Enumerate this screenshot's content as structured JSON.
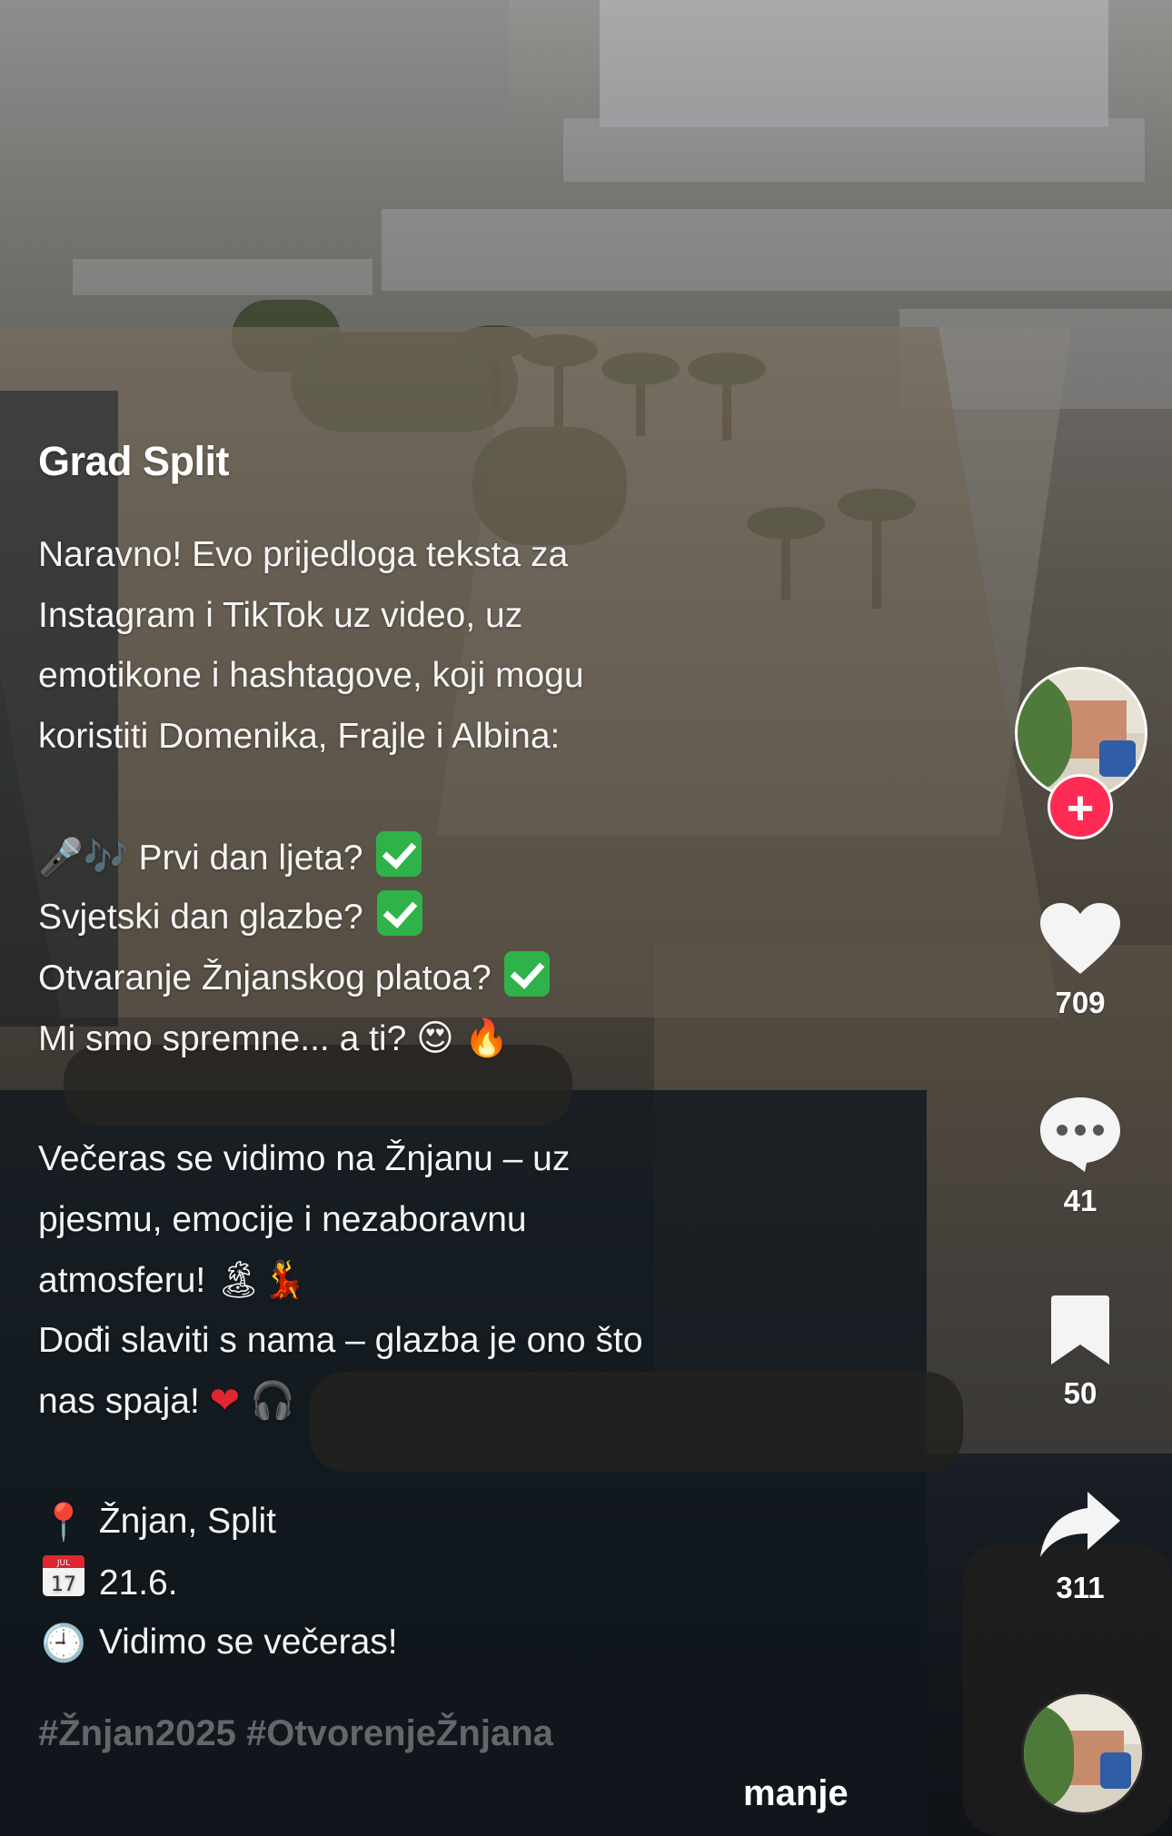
{
  "post": {
    "username": "Grad Split",
    "caption_lines": [
      "Naravno! Evo prijedloga teksta za",
      "Instagram i TikTok uz video, uz",
      "emotikone i hashtagove, koji mogu",
      "koristiti Domenika, Frajle i Albina:"
    ],
    "line_prvi": "Prvi dan ljeta?",
    "line_svjetski": "Svjetski dan glazbe?",
    "line_otvaranje": "Otvaranje Žnjanskog platoa?",
    "line_spremne": "Mi smo spremne... a ti?",
    "line_veceras_1": "Večeras se vidimo na Žnjanu – uz",
    "line_veceras_2": "pjesmu, emocije i nezaboravnu",
    "line_veceras_3": "atmosferu!",
    "line_dodi_1": "Dođi slaviti s nama – glazba je ono što",
    "line_dodi_2": "nas spaja!",
    "location": "Žnjan, Split",
    "date": "21.6.",
    "time_text": "Vidimo se večeras!",
    "calendar_month": "JUL",
    "calendar_day": "17",
    "hashtags": "#Žnjan2025 #OtvorenjeŽnjana",
    "less_label": "manje"
  },
  "actions": {
    "likes": "709",
    "comments": "41",
    "saves": "50",
    "shares": "311",
    "follow_symbol": "+"
  },
  "emoji": {
    "mic": "🎤",
    "notes": "🎶",
    "heart_eyes": "😍",
    "fire": "🔥",
    "beach": "🏝",
    "dancer": "💃",
    "red_heart": "❤",
    "headphones": "🎧",
    "pin": "📍",
    "clock": "🕘"
  },
  "colors": {
    "accent_follow": "#fe2c55",
    "check_green": "#2fb24a"
  }
}
